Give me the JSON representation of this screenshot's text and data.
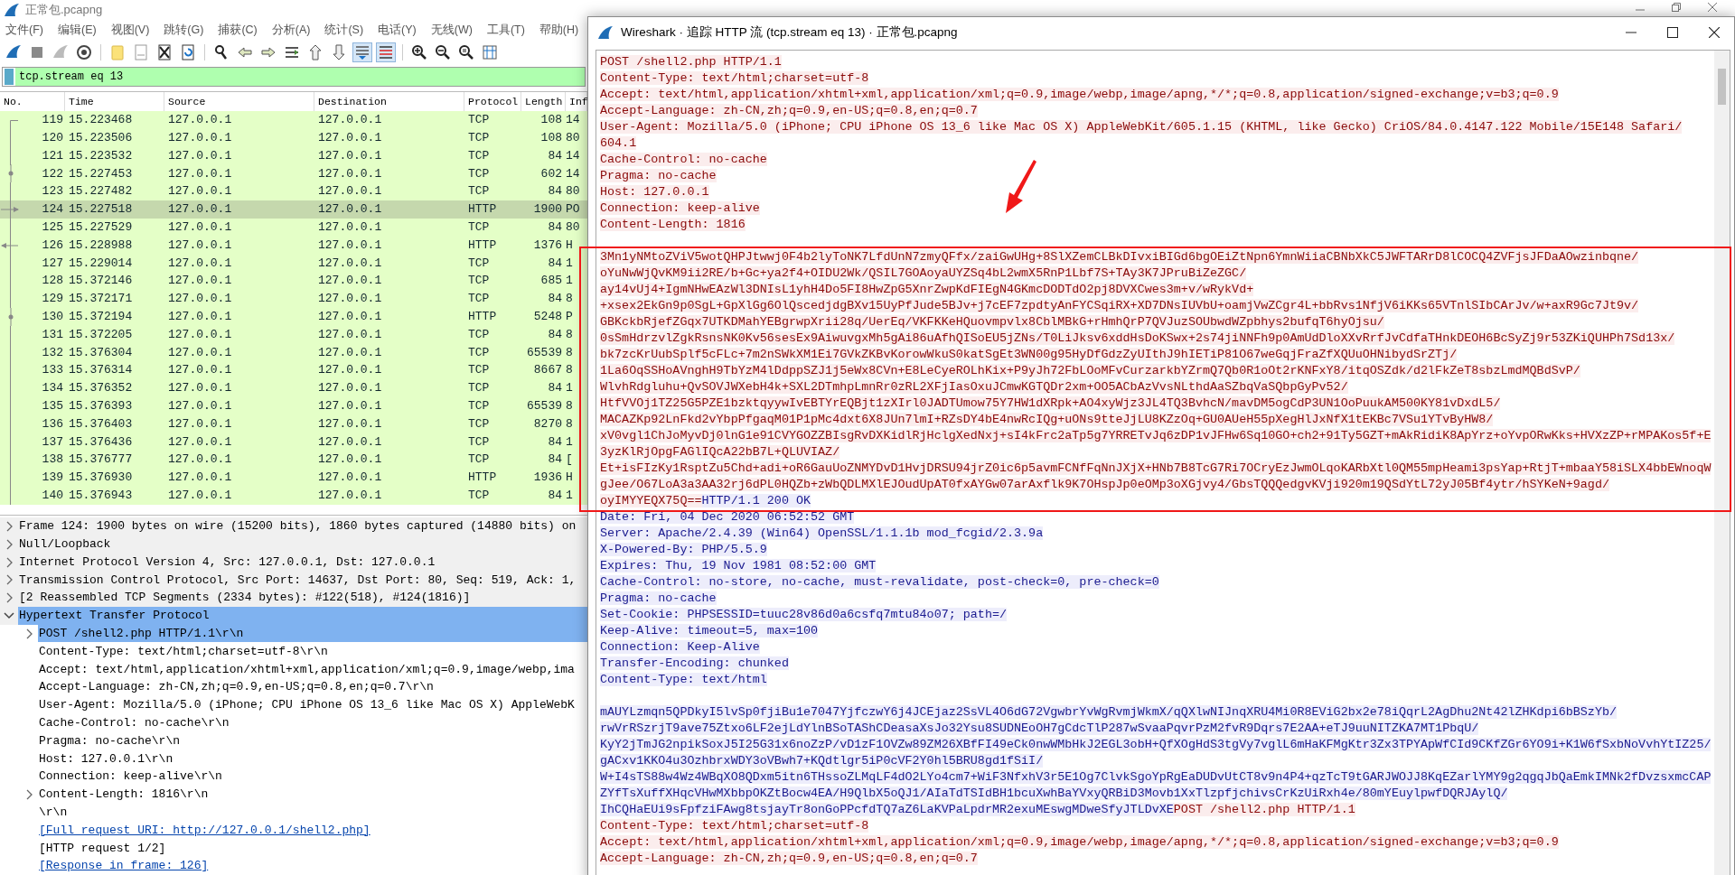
{
  "main_window": {
    "title": "正常包.pcapng",
    "menu": [
      "文件(F)",
      "编辑(E)",
      "视图(V)",
      "跳转(G)",
      "捕获(C)",
      "分析(A)",
      "统计(S)",
      "电话(Y)",
      "无线(W)",
      "工具(T)",
      "帮助(H)"
    ],
    "toolbar": {
      "autoscroll": {
        "on": true
      },
      "colorize": {
        "on": true
      }
    },
    "display_filter": {
      "value": "tcp.stream eq 13"
    },
    "packet_list": {
      "columns": [
        "No.",
        "Time",
        "Source",
        "Destination",
        "Protocol",
        "Length",
        "Inf"
      ],
      "rows": [
        {
          "no": "119",
          "time": "15.223468",
          "source": "127.0.0.1",
          "destination": "127.0.0.1",
          "protocol": "TCP",
          "length": "108",
          "info": "14",
          "kind": "first",
          "selected": false
        },
        {
          "no": "120",
          "time": "15.223506",
          "source": "127.0.0.1",
          "destination": "127.0.0.1",
          "protocol": "TCP",
          "length": "108",
          "info": "80",
          "kind": "line",
          "selected": false
        },
        {
          "no": "121",
          "time": "15.223532",
          "source": "127.0.0.1",
          "destination": "127.0.0.1",
          "protocol": "TCP",
          "length": "84",
          "info": "14",
          "kind": "line",
          "selected": false
        },
        {
          "no": "122",
          "time": "15.227453",
          "source": "127.0.0.1",
          "destination": "127.0.0.1",
          "protocol": "TCP",
          "length": "602",
          "info": "14",
          "kind": "dot",
          "selected": false
        },
        {
          "no": "123",
          "time": "15.227482",
          "source": "127.0.0.1",
          "destination": "127.0.0.1",
          "protocol": "TCP",
          "length": "84",
          "info": "80",
          "kind": "line",
          "selected": false
        },
        {
          "no": "124",
          "time": "15.227518",
          "source": "127.0.0.1",
          "destination": "127.0.0.1",
          "protocol": "HTTP",
          "length": "1900",
          "info": "PO",
          "kind": "request",
          "selected": true
        },
        {
          "no": "125",
          "time": "15.227529",
          "source": "127.0.0.1",
          "destination": "127.0.0.1",
          "protocol": "TCP",
          "length": "84",
          "info": "80",
          "kind": "line",
          "selected": false
        },
        {
          "no": "126",
          "time": "15.228988",
          "source": "127.0.0.1",
          "destination": "127.0.0.1",
          "protocol": "HTTP",
          "length": "1376",
          "info": "H",
          "kind": "response",
          "selected": false
        },
        {
          "no": "127",
          "time": "15.229014",
          "source": "127.0.0.1",
          "destination": "127.0.0.1",
          "protocol": "TCP",
          "length": "84",
          "info": "1",
          "kind": "line",
          "selected": false
        },
        {
          "no": "128",
          "time": "15.372146",
          "source": "127.0.0.1",
          "destination": "127.0.0.1",
          "protocol": "TCP",
          "length": "685",
          "info": "1",
          "kind": "line",
          "selected": false
        },
        {
          "no": "129",
          "time": "15.372171",
          "source": "127.0.0.1",
          "destination": "127.0.0.1",
          "protocol": "TCP",
          "length": "84",
          "info": "8",
          "kind": "line",
          "selected": false
        },
        {
          "no": "130",
          "time": "15.372194",
          "source": "127.0.0.1",
          "destination": "127.0.0.1",
          "protocol": "HTTP",
          "length": "5248",
          "info": "P",
          "kind": "dot",
          "selected": false
        },
        {
          "no": "131",
          "time": "15.372205",
          "source": "127.0.0.1",
          "destination": "127.0.0.1",
          "protocol": "TCP",
          "length": "84",
          "info": "8",
          "kind": "line",
          "selected": false
        },
        {
          "no": "132",
          "time": "15.376304",
          "source": "127.0.0.1",
          "destination": "127.0.0.1",
          "protocol": "TCP",
          "length": "65539",
          "info": "8",
          "kind": "line",
          "selected": false
        },
        {
          "no": "133",
          "time": "15.376314",
          "source": "127.0.0.1",
          "destination": "127.0.0.1",
          "protocol": "TCP",
          "length": "8667",
          "info": "8",
          "kind": "line",
          "selected": false
        },
        {
          "no": "134",
          "time": "15.376352",
          "source": "127.0.0.1",
          "destination": "127.0.0.1",
          "protocol": "TCP",
          "length": "84",
          "info": "1",
          "kind": "line",
          "selected": false
        },
        {
          "no": "135",
          "time": "15.376393",
          "source": "127.0.0.1",
          "destination": "127.0.0.1",
          "protocol": "TCP",
          "length": "65539",
          "info": "8",
          "kind": "line",
          "selected": false
        },
        {
          "no": "136",
          "time": "15.376403",
          "source": "127.0.0.1",
          "destination": "127.0.0.1",
          "protocol": "TCP",
          "length": "8270",
          "info": "8",
          "kind": "line",
          "selected": false
        },
        {
          "no": "137",
          "time": "15.376436",
          "source": "127.0.0.1",
          "destination": "127.0.0.1",
          "protocol": "TCP",
          "length": "84",
          "info": "1",
          "kind": "line",
          "selected": false
        },
        {
          "no": "138",
          "time": "15.376777",
          "source": "127.0.0.1",
          "destination": "127.0.0.1",
          "protocol": "TCP",
          "length": "84",
          "info": "[",
          "kind": "line",
          "selected": false
        },
        {
          "no": "139",
          "time": "15.376930",
          "source": "127.0.0.1",
          "destination": "127.0.0.1",
          "protocol": "HTTP",
          "length": "1936",
          "info": "H",
          "kind": "line",
          "selected": false
        },
        {
          "no": "140",
          "time": "15.376943",
          "source": "127.0.0.1",
          "destination": "127.0.0.1",
          "protocol": "TCP",
          "length": "84",
          "info": "1",
          "kind": "line",
          "selected": false
        }
      ]
    },
    "details": [
      {
        "text": "Frame 124: 1900 bytes on wire (15200 bits), 1860 bytes captured (14880 bits) on",
        "kind": "field",
        "expanded": false,
        "selected": false
      },
      {
        "text": "Null/Loopback",
        "kind": "field",
        "expanded": false,
        "selected": false
      },
      {
        "text": "Internet Protocol Version 4, Src: 127.0.0.1, Dst: 127.0.0.1",
        "kind": "field",
        "expanded": false,
        "selected": false
      },
      {
        "text": "Transmission Control Protocol, Src Port: 14637, Dst Port: 80, Seq: 519, Ack: 1,",
        "kind": "field",
        "expanded": false,
        "selected": false
      },
      {
        "text": "[2 Reassembled TCP Segments (2334 bytes): #122(518), #124(1816)]",
        "kind": "field",
        "expanded": false,
        "selected": false
      },
      {
        "text": "Hypertext Transfer Protocol",
        "kind": "field",
        "expanded": true,
        "selected": true,
        "children": [
          {
            "text": "POST /shell2.php HTTP/1.1\\r\\n",
            "kind": "field",
            "expanded": false,
            "selected": true
          },
          {
            "text": "Content-Type: text/html;charset=utf-8\\r\\n",
            "kind": "field",
            "selected": false
          },
          {
            "text": "Accept: text/html,application/xhtml+xml,application/xml;q=0.9,image/webp,ima",
            "kind": "field",
            "selected": false
          },
          {
            "text": "Accept-Language: zh-CN,zh;q=0.9,en-US;q=0.8,en;q=0.7\\r\\n",
            "kind": "field",
            "selected": false
          },
          {
            "text": "User-Agent: Mozilla/5.0 (iPhone; CPU iPhone OS 13_6 like Mac OS X) AppleWebK",
            "kind": "field",
            "selected": false
          },
          {
            "text": "Cache-Control: no-cache\\r\\n",
            "kind": "field",
            "selected": false
          },
          {
            "text": "Pragma: no-cache\\r\\n",
            "kind": "field",
            "selected": false
          },
          {
            "text": "Host: 127.0.0.1\\r\\n",
            "kind": "field",
            "selected": false
          },
          {
            "text": "Connection: keep-alive\\r\\n",
            "kind": "field",
            "selected": false
          },
          {
            "text": "Content-Length: 1816\\r\\n",
            "kind": "field",
            "expanded": false,
            "selected": false
          },
          {
            "text": "\\r\\n",
            "kind": "field",
            "selected": false
          },
          {
            "text": "[Full request URI: http://127.0.0.1/shell2.php]",
            "kind": "link",
            "selected": false
          },
          {
            "text": "[HTTP request 1/2]",
            "kind": "field",
            "selected": false
          },
          {
            "text": "[Response in frame: 126]",
            "kind": "link",
            "selected": false
          }
        ]
      }
    ]
  },
  "stream_window": {
    "title": "Wireshark · 追踪 HTTP 流 (tcp.stream eq 13) · 正常包.pcapng",
    "lines": [
      {
        "kind": "text",
        "runs": [
          {
            "kind": "client",
            "text": "POST /shell2.php HTTP/1.1"
          }
        ]
      },
      {
        "kind": "text",
        "runs": [
          {
            "kind": "client",
            "text": "Content-Type: text/html;charset=utf-8"
          }
        ]
      },
      {
        "kind": "text",
        "runs": [
          {
            "kind": "client",
            "text": "Accept: text/html,application/xhtml+xml,application/xml;q=0.9,image/webp,image/apng,*/*;q=0.8,application/signed-exchange;v=b3;q=0.9"
          }
        ]
      },
      {
        "kind": "text",
        "runs": [
          {
            "kind": "client",
            "text": "Accept-Language: zh-CN,zh;q=0.9,en-US;q=0.8,en;q=0.7"
          }
        ]
      },
      {
        "kind": "text",
        "runs": [
          {
            "kind": "client",
            "text": "User-Agent: Mozilla/5.0 (iPhone; CPU iPhone OS 13_6 like Mac OS X) AppleWebKit/605.1.15 (KHTML, like Gecko) CriOS/84.0.4147.122 Mobile/15E148 Safari/"
          }
        ]
      },
      {
        "kind": "text",
        "runs": [
          {
            "kind": "client",
            "text": "604.1"
          }
        ]
      },
      {
        "kind": "text",
        "runs": [
          {
            "kind": "client",
            "text": "Cache-Control: no-cache"
          }
        ]
      },
      {
        "kind": "text",
        "runs": [
          {
            "kind": "client",
            "text": "Pragma: no-cache"
          }
        ]
      },
      {
        "kind": "text",
        "runs": [
          {
            "kind": "client",
            "text": "Host: 127.0.0.1"
          }
        ]
      },
      {
        "kind": "text",
        "runs": [
          {
            "kind": "client",
            "text": "Connection: keep-alive"
          }
        ]
      },
      {
        "kind": "text",
        "runs": [
          {
            "kind": "client",
            "text": "Content-Length: 1816"
          }
        ]
      },
      {
        "kind": "blank"
      },
      {
        "kind": "text",
        "runs": [
          {
            "kind": "client",
            "text": "3Mn1yNMtoZViV5wotQHPJtwwj0F4b2lyToNK7LfdUnN7zmyQFfx/zaiGwUHg+8SlXZemCLBkDIvxiBIGd6bgOEiZtNpn6YmnWiiaCBNbXkC5JWFTARrD8lCOCQ4ZVFjsJFDaAOwzinbqne/"
          }
        ]
      },
      {
        "kind": "text",
        "runs": [
          {
            "kind": "client",
            "text": "oYuNwWjQvKM9ii2RE/b+Gc+ya2f4+OIDU2Wk/QSIL7GOAoyaUYZSq4bL2wmX5RnP1Lbf7S+TAy3K7JPruBiZeZGC/"
          }
        ]
      },
      {
        "kind": "text",
        "runs": [
          {
            "kind": "client",
            "text": "ay14vUj4+IgmNHwEAzWl3DNIsL1yhH4Do5FI8HwZpG5XnrZwpKdFIEgN4GKmcDODTdO2pj8DVXCwes3m+v/wRykVd+"
          }
        ]
      },
      {
        "kind": "text",
        "runs": [
          {
            "kind": "client",
            "text": "+xsex2EkGn9p0SgL+GpXlGg6OlQscedjdgBXv15UyPfJude5BJv+j7cEF7zpdtyAnFYCSqiRX+XD7DNsIUVbU+oamjVwZCgr4L+bbRvs1NfjV6iKKs65VTnlSIbCArJv/w+axR9Gc7Jt9v/"
          }
        ]
      },
      {
        "kind": "text",
        "runs": [
          {
            "kind": "client",
            "text": "GBKckbRjefZGqx7UTKDMahYEBgrwpXrii28q/UerEq/VKFKKeHQuovmpvlx8CblMBkG+rHmhQrP7QVJuzSOUbwdWZpbhys2bufqT6hyOjsu/"
          }
        ]
      },
      {
        "kind": "text",
        "runs": [
          {
            "kind": "client",
            "text": "0sSmHdrzvlZgkRsnsNK0Kv56sesEx9AiwuvgxMh5gAi86uAfhQISoEU5jZNs/T0LiJksv6xddHsDoKSwx+2s74jiNNFh9p0AmUdDloXXvRrfJvCdfaTHnkDEOH6BcSyZj9r53ZKiQUHPh7Sd13x/"
          }
        ]
      },
      {
        "kind": "text",
        "runs": [
          {
            "kind": "client",
            "text": "bk7zcKrUubSplf5cFLc+7m2nSWkXM1Ei7GVkZKBvKorowWkuS0katSgEt3WN00g95HyDfGdzZyUIthJ9hIETiP81O67weGqjFraZfXQUuOHNibydSrZTj/"
          }
        ]
      },
      {
        "kind": "text",
        "runs": [
          {
            "kind": "client",
            "text": "1La6OqSSHoAVnghH9TbYzM4lDdppSZJ1j5eWx8CVn+E8LeCyeROLhKix+P9yJh72FbLOoMFvCurzarkbYZrmQ7Qb0R1oOt2rKNFxY8/itqOSZdk/d2lFkZeT8sbzLmdMQBdSvP/"
          }
        ]
      },
      {
        "kind": "text",
        "runs": [
          {
            "kind": "client",
            "text": "WlvhRdgluhu+QvSOVJWXebH4k+SXL2DTmhpLmnRr0zRL2XFjIasOxuJCmwKGTQDr2xm+OO5ACbAzVvsNLthdAaSZbqVaSQbpGyPv52/"
          }
        ]
      },
      {
        "kind": "text",
        "runs": [
          {
            "kind": "client",
            "text": "HtfVVOj1TZ25G5PZE1bzktqyywIvEBTYrEQBjt1zXIrl0JADTUmow75Y7HW1dXRpk+AO4xyWjz3JL4TQ3BvhcN/mavDM5ogCdP3UN1OoPuukAM500KY81vDxdL5/"
          }
        ]
      },
      {
        "kind": "text",
        "runs": [
          {
            "kind": "client",
            "text": "MACAZKp92LnFkd2vYbpPfgaqM01P1pMc4dxt6X8JUn7lmI+RZsDY4bE4nwRcIQg+uONs9tteJjLU8KZzOq+GU0AUeH55pXegHlJxNfX1tEKBc7VSu1YTvByHW8/"
          }
        ]
      },
      {
        "kind": "text",
        "runs": [
          {
            "kind": "client",
            "text": "xV0vgl1ChJoMyvDj0lnG1e91CVYGOZZBIsgRvDXKidlRjHclgXedNxj+sI4kFrc2aTp5g7YRRETvJq6zDP1vJFHw6Sq10GO+ch2+91Ty5GZT+mAkRidiK8ApYrz+oYvpORwKks+HVXzZP+rMPAKos5f+E"
          }
        ]
      },
      {
        "kind": "text",
        "runs": [
          {
            "kind": "client",
            "text": "3yzKlRjOpgFAGlIQcA22bB7L+QLUVIAZ/"
          }
        ]
      },
      {
        "kind": "text",
        "runs": [
          {
            "kind": "client",
            "text": "Et+isFIzKy1RsptZu5Chd+adi+oR6GauUoZNMYDvD1HvjDRSU94jrZ0ic6p5avmFCNfFqNnJXjX+HNb7B8TcG7Ri7OCryEzJwmOLqoKARbXtl0QM55mpHeami3psYap+RtjT+mbaaY58iSLX4bbEWnoqW"
          }
        ]
      },
      {
        "kind": "text",
        "runs": [
          {
            "kind": "client",
            "text": "gJee/O67LoA3a3AA32rj6dPL0HQZb+zWbQDLMXlEJOudUpAT0fxAYGw07arAxflk9K7OHspJp0eOMp3oXGjvy4/GbsTQQQedgvKVji920m19QSdYtL72yJ05Bf4ytr/hSYKeN+9agd/"
          }
        ]
      },
      {
        "kind": "text",
        "runs": [
          {
            "kind": "client",
            "text": "oyIMYYEQX75Q=="
          },
          {
            "kind": "server",
            "text": "HTTP/1.1 200 OK"
          }
        ]
      },
      {
        "kind": "text",
        "runs": [
          {
            "kind": "server",
            "text": "Date: Fri, 04 Dec 2020 06:52:52 GMT"
          }
        ]
      },
      {
        "kind": "text",
        "runs": [
          {
            "kind": "server",
            "text": "Server: Apache/2.4.39 (Win64) OpenSSL/1.1.1b mod_fcgid/2.3.9a"
          }
        ]
      },
      {
        "kind": "text",
        "runs": [
          {
            "kind": "server",
            "text": "X-Powered-By: PHP/5.5.9"
          }
        ]
      },
      {
        "kind": "text",
        "runs": [
          {
            "kind": "server",
            "text": "Expires: Thu, 19 Nov 1981 08:52:00 GMT"
          }
        ]
      },
      {
        "kind": "text",
        "runs": [
          {
            "kind": "server",
            "text": "Cache-Control: no-store, no-cache, must-revalidate, post-check=0, pre-check=0"
          }
        ]
      },
      {
        "kind": "text",
        "runs": [
          {
            "kind": "server",
            "text": "Pragma: no-cache"
          }
        ]
      },
      {
        "kind": "text",
        "runs": [
          {
            "kind": "server",
            "text": "Set-Cookie: PHPSESSID=tuuc28v86d0a6csfq7mtu84o07; path=/"
          }
        ]
      },
      {
        "kind": "text",
        "runs": [
          {
            "kind": "server",
            "text": "Keep-Alive: timeout=5, max=100"
          }
        ]
      },
      {
        "kind": "text",
        "runs": [
          {
            "kind": "server",
            "text": "Connection: Keep-Alive"
          }
        ]
      },
      {
        "kind": "text",
        "runs": [
          {
            "kind": "server",
            "text": "Transfer-Encoding: chunked"
          }
        ]
      },
      {
        "kind": "text",
        "runs": [
          {
            "kind": "server",
            "text": "Content-Type: text/html"
          }
        ]
      },
      {
        "kind": "blank"
      },
      {
        "kind": "text",
        "runs": [
          {
            "kind": "server",
            "text": "mAUYLzmqn5QPDkyI5lvSp0fjiBu1e7047YjfczwY6j4JCEjaz2SsVL4O6dG72VgwbrYvWgRvmjWkmX/qQXlwNIJnqXRU4Mi0R8EViG2bx2e78iQqrL2AgDhu2Nt42lZHKdpi6bBSzYb/"
          }
        ]
      },
      {
        "kind": "text",
        "runs": [
          {
            "kind": "server",
            "text": "rwVrRSzrjT9ave75Ztxo6LF2ejLdYlnBSoTAShCDeasaXsJo32Ysu8SUDNEoOH7gCdcTlP287wSvaaPqvrPzM2fvR9Dqrs7E2AA+eTJ9uuNITZKA7MT1PbqU/"
          }
        ]
      },
      {
        "kind": "text",
        "runs": [
          {
            "kind": "server",
            "text": "KyY2jTmJG2npikSoxJ5I25G31x6noZzP/vD1zF1OVZw89ZM26XBfFI49eCk0nwWMbHkJ2EGL3obH+QfXOgHdS3tgVy7vglL6mHaKFMgKtr3Zx3TPYApWfCId9CKfZGr6YO9i+K1W6fSxbNoVvhYtIZ25/"
          }
        ]
      },
      {
        "kind": "text",
        "runs": [
          {
            "kind": "server",
            "text": "gACxv1KKO4u3OzhbrxWDY3oVBwh7+KQdtlgr5iP0cVF2Y0hl5BRU8gd1fSiI/"
          }
        ]
      },
      {
        "kind": "text",
        "runs": [
          {
            "kind": "server",
            "text": "W+I4sTS88w4Wz4WBqXO8QDxm5itn6THssoZLMqLF4dO2LYo4cm7+WiF3NfxhV3r5E1Og7ClvkSgoYpRgEaDUDvUtCT8v9n4P4+qzTcT9tGARJWOJJ8KqEZarlYMY9g2qgqJbQaEmkIMNk2fDvzsxmcCAP"
          }
        ]
      },
      {
        "kind": "text",
        "runs": [
          {
            "kind": "server",
            "text": "ZYfTsXuffXHqcVHwMXbbpOKZtBocw4EA/H9QlbX5oQJ1/AIaTdTSIdBH1bcuXwhBaYVxyQRBiD3Movb1XxTlzpfjchivsCrKzUiRxh4e/80mYEuylpwfDQRJAylQ/"
          }
        ]
      },
      {
        "kind": "text",
        "runs": [
          {
            "kind": "server",
            "text": "IhCQHaEUi9sFpfziFAwg8tsjayTr8onGoPPcfdTQ7aZ6LaKVPaLpdrMR2exuMEswgMDweSfyJTLDvXE"
          },
          {
            "kind": "client",
            "text": "POST /shell2.php HTTP/1.1"
          }
        ]
      },
      {
        "kind": "text",
        "runs": [
          {
            "kind": "client",
            "text": "Content-Type: text/html;charset=utf-8"
          }
        ]
      },
      {
        "kind": "text",
        "runs": [
          {
            "kind": "client",
            "text": "Accept: text/html,application/xhtml+xml,application/xml;q=0.9,image/webp,image/apng,*/*;q=0.8,application/signed-exchange;v=b3;q=0.9"
          }
        ]
      },
      {
        "kind": "text",
        "runs": [
          {
            "kind": "client",
            "text": "Accept-Language: zh-CN,zh;q=0.9,en-US;q=0.8,en;q=0.7"
          }
        ]
      }
    ]
  }
}
